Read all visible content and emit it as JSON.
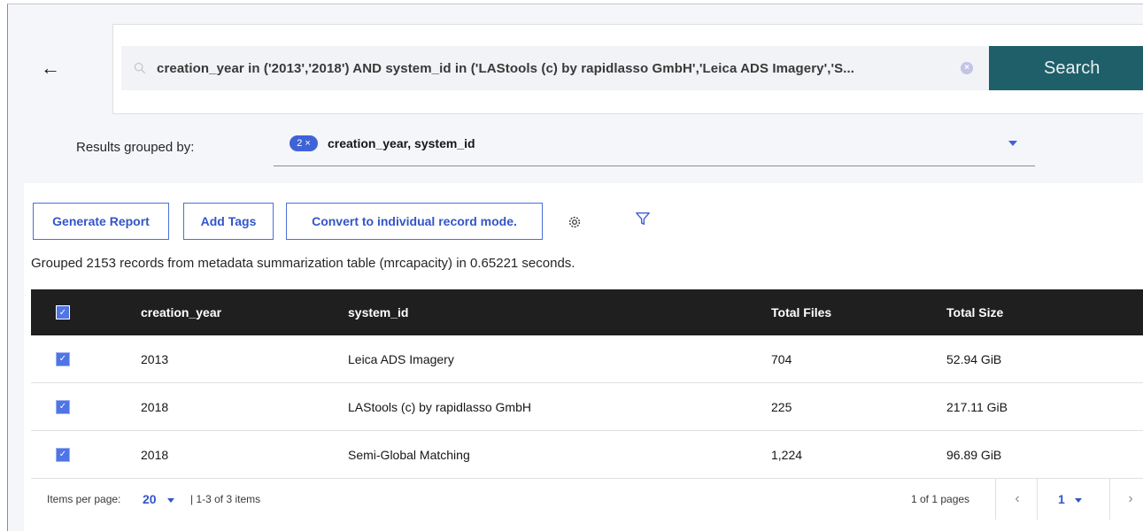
{
  "back": {
    "label": "←"
  },
  "search": {
    "query": "creation_year in ('2013','2018') AND system_id in ('LAStools (c) by rapidlasso GmbH','Leica ADS Imagery','S...",
    "clear_symbol": "×",
    "button_label": "Search"
  },
  "grouping": {
    "label": "Results grouped by:",
    "chip_count": "2",
    "chip_close": "×",
    "value": "creation_year, system_id"
  },
  "toolbar": {
    "generate_report": "Generate Report",
    "add_tags": "Add Tags",
    "convert_mode": "Convert to individual record mode."
  },
  "summary": "Grouped 2153 records from metadata summarization table (mrcapacity) in 0.65221 seconds.",
  "table": {
    "headers": {
      "creation_year": "creation_year",
      "system_id": "system_id",
      "total_files": "Total Files",
      "total_size": "Total Size"
    },
    "rows": [
      {
        "creation_year": "2013",
        "system_id": "Leica ADS Imagery",
        "total_files": "704",
        "total_size": "52.94 GiB",
        "checked": true
      },
      {
        "creation_year": "2018",
        "system_id": "LAStools (c) by rapidlasso GmbH",
        "total_files": "225",
        "total_size": "217.11 GiB",
        "checked": true
      },
      {
        "creation_year": "2018",
        "system_id": "Semi-Global Matching",
        "total_files": "1,224",
        "total_size": "96.89 GiB",
        "checked": true
      }
    ],
    "check_mark": "✓"
  },
  "pagination": {
    "items_per_page_label": "Items per page:",
    "items_per_page_value": "20",
    "range": "| 1-3 of 3 items",
    "pages": "1 of 1 pages",
    "current_page": "1",
    "prev": "‹",
    "next": "›"
  },
  "colors": {
    "search_button": "#1e5f69",
    "accent": "#3f63d6",
    "table_header": "#1f1f1f"
  }
}
